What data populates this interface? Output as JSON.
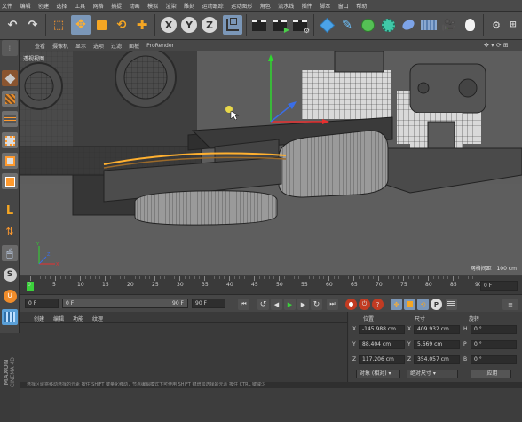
{
  "menu": [
    "文件",
    "编辑",
    "创建",
    "选择",
    "工具",
    "网格",
    "捕捉",
    "动画",
    "模拟",
    "渲染",
    "雕刻",
    "运动跟踪",
    "运动图形",
    "角色",
    "流水线",
    "插件",
    "脚本",
    "窗口",
    "帮助"
  ],
  "toolbar": {
    "x_label": "X",
    "y_label": "Y",
    "z_label": "Z",
    "icons": [
      "undo-icon",
      "selection-icon",
      "move-icon",
      "scale-icon",
      "rotate-icon",
      "add-icon",
      "axis-x-icon",
      "axis-y-icon",
      "axis-z-icon",
      "coordinate-system-icon",
      "render-view-icon",
      "render-picture-icon",
      "render-settings-icon",
      "cube-icon",
      "pen-icon",
      "subdivision-icon",
      "array-icon",
      "deformer-icon",
      "floor-icon",
      "camera-icon",
      "light-icon"
    ]
  },
  "viewport_menu": [
    "查看",
    "摄像机",
    "显示",
    "选项",
    "过滤",
    "面板",
    "ProRender"
  ],
  "viewport": {
    "title": "透视视图",
    "grid_spacing": "网格间距 : 100 cm",
    "bg_color": "#5d5d5d"
  },
  "timeline": {
    "ticks": [
      "0",
      "5",
      "10",
      "15",
      "20",
      "25",
      "30",
      "35",
      "40",
      "45",
      "50",
      "55",
      "60",
      "65",
      "70",
      "75",
      "80",
      "85",
      "90"
    ],
    "current_frame": "0 F"
  },
  "playback": {
    "start": "0 F",
    "range_start": "0 F",
    "range_end": "90 F",
    "end": "90 F"
  },
  "materials": {
    "menu": [
      "创建",
      "编辑",
      "功能",
      "纹理"
    ]
  },
  "brand": {
    "maxon": "MAXON",
    "product": "CINEMA 4D"
  },
  "coords": {
    "headers": [
      "位置",
      "尺寸",
      "旋转"
    ],
    "rows": [
      {
        "axis": "X",
        "pos": "-145.988 cm",
        "size_axis": "X",
        "size": "409.932 cm",
        "rot_axis": "H",
        "rot": "0 °"
      },
      {
        "axis": "Y",
        "pos": "88.404 cm",
        "size_axis": "Y",
        "size": "5.669 cm",
        "rot_axis": "P",
        "rot": "0 °"
      },
      {
        "axis": "Z",
        "pos": "117.206 cm",
        "size_axis": "Z",
        "size": "354.057 cm",
        "rot_axis": "B",
        "rot": "0 °"
      }
    ],
    "mode_select": "对象 (相对)",
    "size_select": "绝对尺寸",
    "apply_label": "应用"
  },
  "status": "选择区域将移动选择的元素 按住 SHIFT 键量化移动，节点编辑模式下可使用 SHIFT 键增加选择的元素 按住 CTRL 键减少"
}
